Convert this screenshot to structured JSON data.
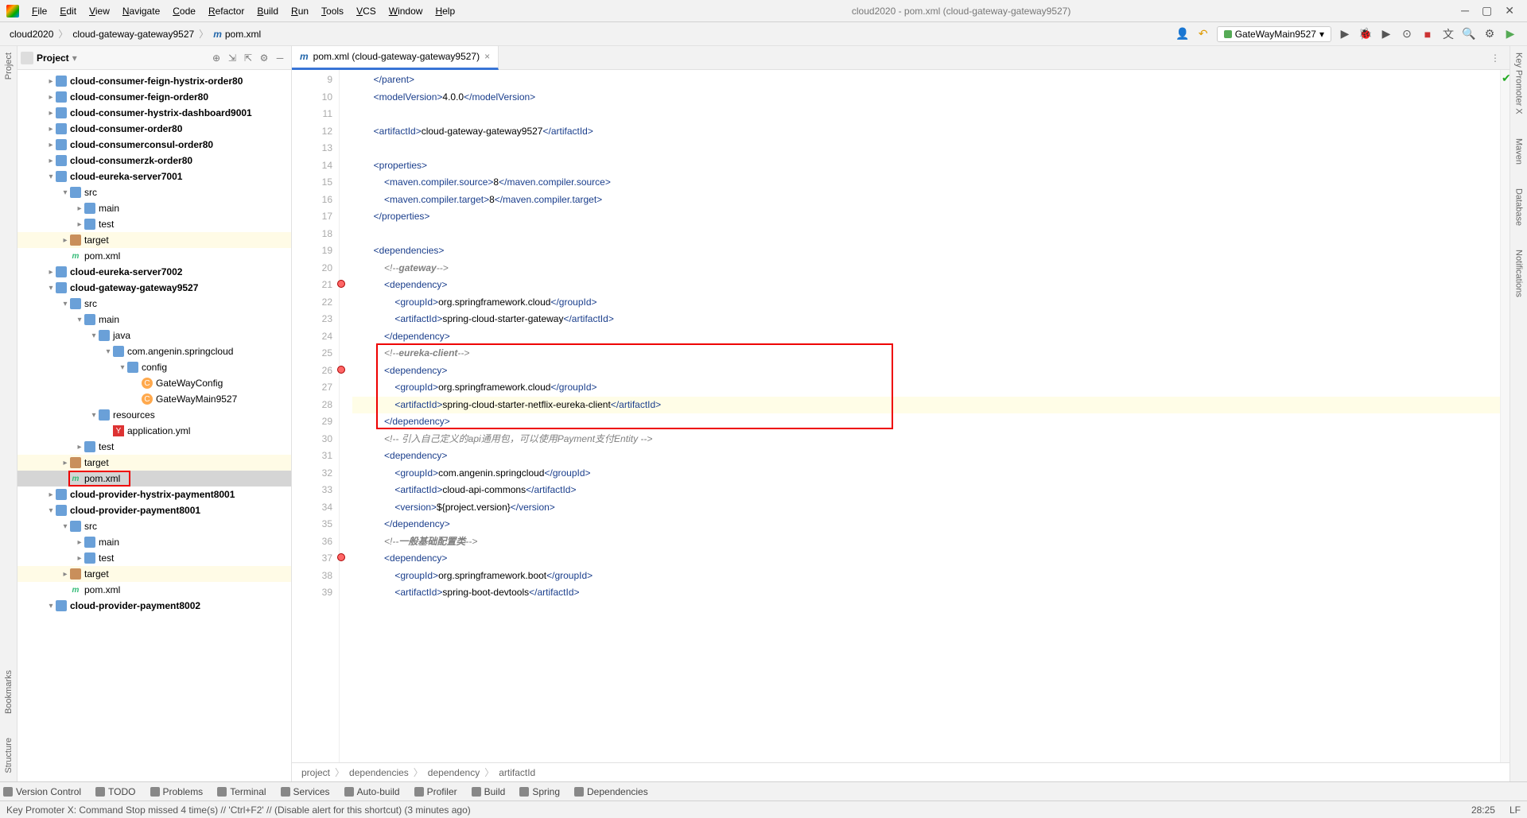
{
  "window": {
    "title": "cloud2020 - pom.xml (cloud-gateway-gateway9527)",
    "menu": [
      "File",
      "Edit",
      "View",
      "Navigate",
      "Code",
      "Refactor",
      "Build",
      "Run",
      "Tools",
      "VCS",
      "Window",
      "Help"
    ]
  },
  "breadcrumb": {
    "items": [
      "cloud2020",
      "cloud-gateway-gateway9527",
      "pom.xml"
    ]
  },
  "toolbar": {
    "run_config": "GateWayMain9527"
  },
  "project_panel": {
    "title": "Project"
  },
  "tree": [
    {
      "d": 2,
      "arrow": ">",
      "icon": "fold-c",
      "label": "cloud-consumer-feign-hystrix-order80",
      "bold": true
    },
    {
      "d": 2,
      "arrow": ">",
      "icon": "fold-c",
      "label": "cloud-consumer-feign-order80",
      "bold": true
    },
    {
      "d": 2,
      "arrow": ">",
      "icon": "fold-c",
      "label": "cloud-consumer-hystrix-dashboard9001",
      "bold": true
    },
    {
      "d": 2,
      "arrow": ">",
      "icon": "fold-c",
      "label": "cloud-consumer-order80",
      "bold": true
    },
    {
      "d": 2,
      "arrow": ">",
      "icon": "fold-c",
      "label": "cloud-consumerconsul-order80",
      "bold": true
    },
    {
      "d": 2,
      "arrow": ">",
      "icon": "fold-c",
      "label": "cloud-consumerzk-order80",
      "bold": true
    },
    {
      "d": 2,
      "arrow": "v",
      "icon": "fold-c",
      "label": "cloud-eureka-server7001",
      "bold": true
    },
    {
      "d": 3,
      "arrow": "v",
      "icon": "fold-c",
      "label": "src"
    },
    {
      "d": 4,
      "arrow": ">",
      "icon": "fold-c",
      "label": "main"
    },
    {
      "d": 4,
      "arrow": ">",
      "icon": "fold-c",
      "label": "test"
    },
    {
      "d": 3,
      "arrow": ">",
      "icon": "fold",
      "label": "target",
      "hl": true
    },
    {
      "d": 3,
      "arrow": "",
      "icon": "file-m",
      "label": "pom.xml"
    },
    {
      "d": 2,
      "arrow": ">",
      "icon": "fold-c",
      "label": "cloud-eureka-server7002",
      "bold": true
    },
    {
      "d": 2,
      "arrow": "v",
      "icon": "fold-c",
      "label": "cloud-gateway-gateway9527",
      "bold": true
    },
    {
      "d": 3,
      "arrow": "v",
      "icon": "fold-c",
      "label": "src"
    },
    {
      "d": 4,
      "arrow": "v",
      "icon": "fold-c",
      "label": "main"
    },
    {
      "d": 5,
      "arrow": "v",
      "icon": "fold-c",
      "label": "java"
    },
    {
      "d": 6,
      "arrow": "v",
      "icon": "fold-c",
      "label": "com.angenin.springcloud"
    },
    {
      "d": 7,
      "arrow": "v",
      "icon": "fold-c",
      "label": "config"
    },
    {
      "d": 8,
      "arrow": "",
      "icon": "file-j",
      "label": "GateWayConfig"
    },
    {
      "d": 8,
      "arrow": "",
      "icon": "file-j",
      "label": "GateWayMain9527"
    },
    {
      "d": 5,
      "arrow": "v",
      "icon": "fold-c",
      "label": "resources"
    },
    {
      "d": 6,
      "arrow": "",
      "icon": "file-y",
      "label": "application.yml"
    },
    {
      "d": 4,
      "arrow": ">",
      "icon": "fold-c",
      "label": "test"
    },
    {
      "d": 3,
      "arrow": ">",
      "icon": "fold",
      "label": "target",
      "hl": true
    },
    {
      "d": 3,
      "arrow": "",
      "icon": "file-m",
      "label": "pom.xml",
      "sel": true,
      "redbox": true
    },
    {
      "d": 2,
      "arrow": ">",
      "icon": "fold-c",
      "label": "cloud-provider-hystrix-payment8001",
      "bold": true
    },
    {
      "d": 2,
      "arrow": "v",
      "icon": "fold-c",
      "label": "cloud-provider-payment8001",
      "bold": true
    },
    {
      "d": 3,
      "arrow": "v",
      "icon": "fold-c",
      "label": "src"
    },
    {
      "d": 4,
      "arrow": ">",
      "icon": "fold-c",
      "label": "main"
    },
    {
      "d": 4,
      "arrow": ">",
      "icon": "fold-c",
      "label": "test"
    },
    {
      "d": 3,
      "arrow": ">",
      "icon": "fold",
      "label": "target",
      "hl": true
    },
    {
      "d": 3,
      "arrow": "",
      "icon": "file-m",
      "label": "pom.xml"
    },
    {
      "d": 2,
      "arrow": "v",
      "icon": "fold-c",
      "label": "cloud-provider-payment8002",
      "bold": true
    }
  ],
  "tab": {
    "label": "pom.xml (cloud-gateway-gateway9527)"
  },
  "gutter": {
    "start": 9,
    "end": 39,
    "marks": {
      "21": "ci",
      "26": "ci",
      "37": "ci"
    }
  },
  "code": [
    {
      "n": 9,
      "indent": 2,
      "html": "<span class='tag'>&lt;/parent&gt;</span>"
    },
    {
      "n": 10,
      "indent": 2,
      "html": "<span class='tag'>&lt;modelVersion&gt;</span><span class='txt'>4.0.0</span><span class='tag'>&lt;/modelVersion&gt;</span>"
    },
    {
      "n": 11,
      "indent": 0,
      "html": ""
    },
    {
      "n": 12,
      "indent": 2,
      "html": "<span class='tag'>&lt;artifactId&gt;</span><span class='txt'>cloud-gateway-gateway9527</span><span class='tag'>&lt;/artifactId&gt;</span>"
    },
    {
      "n": 13,
      "indent": 0,
      "html": ""
    },
    {
      "n": 14,
      "indent": 2,
      "html": "<span class='tag'>&lt;properties&gt;</span>"
    },
    {
      "n": 15,
      "indent": 3,
      "html": "<span class='tag'>&lt;maven.compiler.source&gt;</span><span class='txt'>8</span><span class='tag'>&lt;/maven.compiler.source&gt;</span>"
    },
    {
      "n": 16,
      "indent": 3,
      "html": "<span class='tag'>&lt;maven.compiler.target&gt;</span><span class='txt'>8</span><span class='tag'>&lt;/maven.compiler.target&gt;</span>"
    },
    {
      "n": 17,
      "indent": 2,
      "html": "<span class='tag'>&lt;/properties&gt;</span>"
    },
    {
      "n": 18,
      "indent": 0,
      "html": ""
    },
    {
      "n": 19,
      "indent": 2,
      "html": "<span class='tag'>&lt;dependencies&gt;</span>"
    },
    {
      "n": 20,
      "indent": 3,
      "html": "<span class='cmt'>&lt;!--</span><span class='cmt-b'>gateway</span><span class='cmt'>--&gt;</span>"
    },
    {
      "n": 21,
      "indent": 3,
      "html": "<span class='tag'>&lt;dependency&gt;</span>"
    },
    {
      "n": 22,
      "indent": 4,
      "html": "<span class='tag'>&lt;groupId&gt;</span><span class='txt'>org.springframework.cloud</span><span class='tag'>&lt;/groupId&gt;</span>"
    },
    {
      "n": 23,
      "indent": 4,
      "html": "<span class='tag'>&lt;artifactId&gt;</span><span class='txt'>spring-cloud-starter-gateway</span><span class='tag'>&lt;/artifactId&gt;</span>"
    },
    {
      "n": 24,
      "indent": 3,
      "html": "<span class='tag'>&lt;/dependency&gt;</span>"
    },
    {
      "n": 25,
      "indent": 3,
      "html": "<span class='cmt'>&lt;!--</span><span class='cmt-b'>eureka-client</span><span class='cmt'>--&gt;</span>"
    },
    {
      "n": 26,
      "indent": 3,
      "html": "<span class='tag'>&lt;dependency&gt;</span>"
    },
    {
      "n": 27,
      "indent": 4,
      "html": "<span class='tag'>&lt;groupId&gt;</span><span class='txt'>org.springframework.cloud</span><span class='tag'>&lt;/groupId&gt;</span>"
    },
    {
      "n": 28,
      "indent": 4,
      "html": "<span class='tag'>&lt;artifactId&gt;</span><span class='txt'>spring-cloud-starter-netflix-eureka-client</span><span class='tag'>&lt;/artifactId&gt;</span>",
      "current": true
    },
    {
      "n": 29,
      "indent": 3,
      "html": "<span class='tag'>&lt;/dependency&gt;</span>"
    },
    {
      "n": 30,
      "indent": 3,
      "html": "<span class='cmt'>&lt;!-- 引入自己定义的api通用包，可以使用Payment支付Entity --&gt;</span>"
    },
    {
      "n": 31,
      "indent": 3,
      "html": "<span class='tag'>&lt;dependency&gt;</span>"
    },
    {
      "n": 32,
      "indent": 4,
      "html": "<span class='tag'>&lt;groupId&gt;</span><span class='txt'>com.angenin.springcloud</span><span class='tag'>&lt;/groupId&gt;</span>"
    },
    {
      "n": 33,
      "indent": 4,
      "html": "<span class='tag'>&lt;artifactId&gt;</span><span class='txt'>cloud-api-commons</span><span class='tag'>&lt;/artifactId&gt;</span>"
    },
    {
      "n": 34,
      "indent": 4,
      "html": "<span class='tag'>&lt;version&gt;</span><span class='txt'>${project.version}</span><span class='tag'>&lt;/version&gt;</span>"
    },
    {
      "n": 35,
      "indent": 3,
      "html": "<span class='tag'>&lt;/dependency&gt;</span>"
    },
    {
      "n": 36,
      "indent": 3,
      "html": "<span class='cmt'>&lt;!--</span><span class='cmt-b'>一般基础配置类</span><span class='cmt'>--&gt;</span>"
    },
    {
      "n": 37,
      "indent": 3,
      "html": "<span class='tag'>&lt;dependency&gt;</span>"
    },
    {
      "n": 38,
      "indent": 4,
      "html": "<span class='tag'>&lt;groupId&gt;</span><span class='txt'>org.springframework.boot</span><span class='tag'>&lt;/groupId&gt;</span>"
    },
    {
      "n": 39,
      "indent": 4,
      "html": "<span class='tag'>&lt;artifactId&gt;</span><span class='txt'>spring-boot-devtools</span><span class='tag'>&lt;/artifactId&gt;</span>"
    }
  ],
  "red_box": {
    "top_line": 25,
    "bottom_line": 29
  },
  "code_crumb": [
    "project",
    "dependencies",
    "dependency",
    "artifactId"
  ],
  "bottom_tools": [
    "Version Control",
    "TODO",
    "Problems",
    "Terminal",
    "Services",
    "Auto-build",
    "Profiler",
    "Build",
    "Spring",
    "Dependencies"
  ],
  "status": {
    "msg": "Key Promoter X: Command Stop missed 4 time(s) // 'Ctrl+F2' // (Disable alert for this shortcut) (3 minutes ago)",
    "pos": "28:25",
    "enc": "LF"
  },
  "left_stripe": [
    "Project",
    "Bookmarks",
    "Structure"
  ],
  "right_stripe": [
    "Key Promoter X",
    "Maven",
    "Database",
    "Notifications"
  ]
}
